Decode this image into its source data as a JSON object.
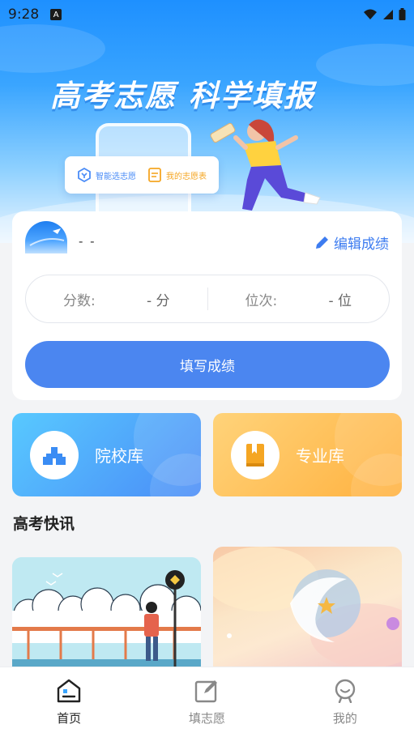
{
  "status_bar": {
    "time": "9:28",
    "notif_letter": "A"
  },
  "hero": {
    "title": "高考志愿 科学填报",
    "tags": [
      {
        "label": "智能选志愿",
        "icon": "smart-select-icon",
        "color": "#4a8cf7"
      },
      {
        "label": "我的志愿表",
        "icon": "document-icon",
        "color": "#f5a623"
      }
    ]
  },
  "profile": {
    "name": "- -",
    "edit_label": "编辑成绩"
  },
  "score": {
    "score_label": "分数:",
    "score_value": "- 分",
    "rank_label": "位次:",
    "rank_value": "- 位"
  },
  "fill_button": "填写成绩",
  "libraries": [
    {
      "label": "院校库",
      "icon": "school-icon"
    },
    {
      "label": "专业库",
      "icon": "book-icon"
    }
  ],
  "news": {
    "section_title": "高考快讯"
  },
  "bottom_nav": [
    {
      "label": "首页",
      "icon": "home-icon",
      "active": true
    },
    {
      "label": "填志愿",
      "icon": "edit-icon",
      "active": false
    },
    {
      "label": "我的",
      "icon": "profile-icon",
      "active": false
    }
  ],
  "colors": {
    "accent": "#4b86f0",
    "edit_text": "#3d7cf0",
    "orange": "#ffb13f"
  }
}
